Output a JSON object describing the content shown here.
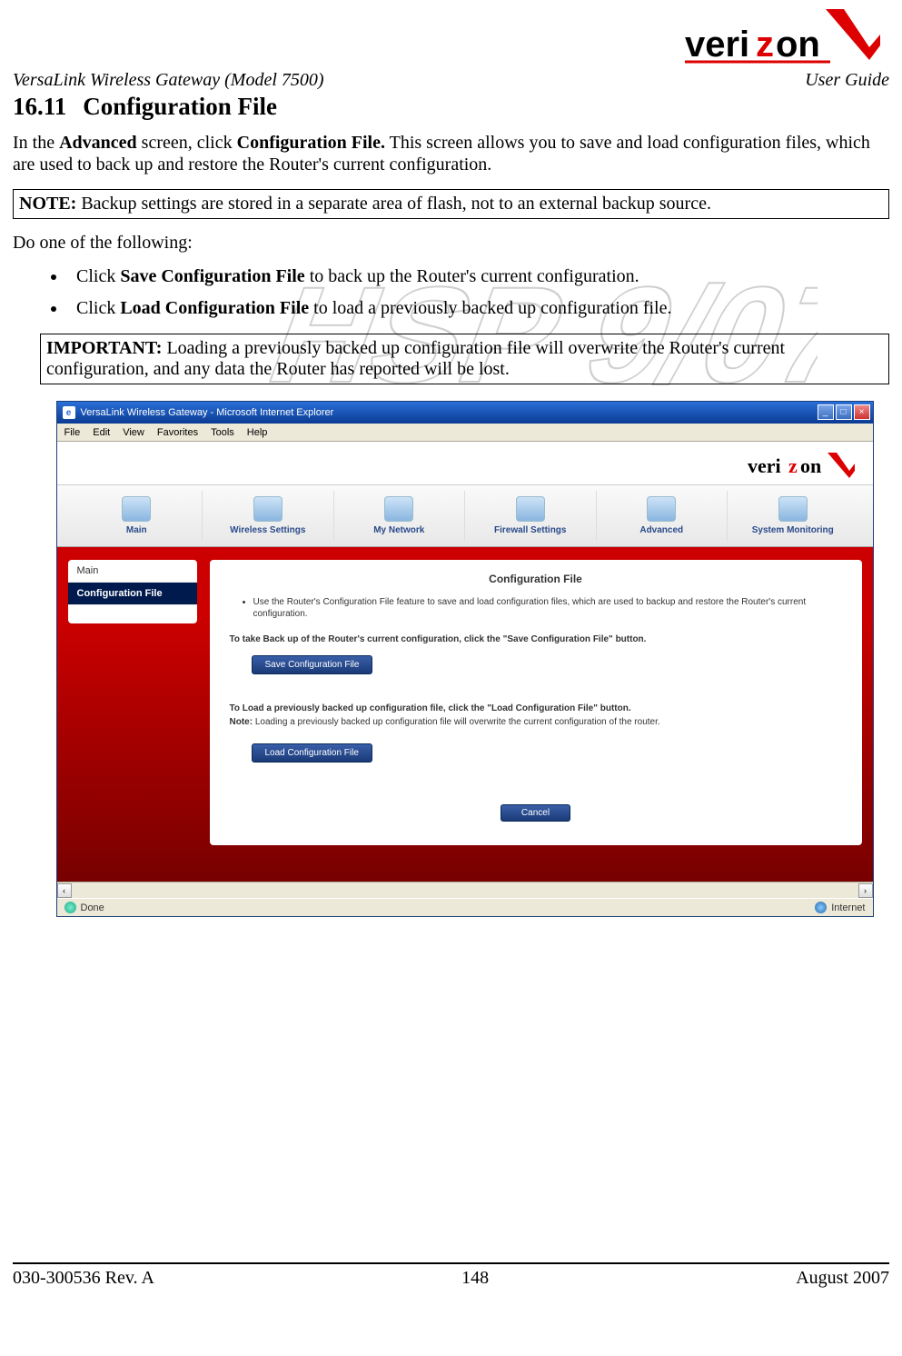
{
  "logo_text": "verizon",
  "doc_header_left": "VersaLink Wireless Gateway (Model 7500)",
  "doc_header_right": "User Guide",
  "section_number": "16.11",
  "section_title": "Configuration File",
  "intro_1a": "In the ",
  "intro_1b": "Advanced",
  "intro_1c": " screen, click ",
  "intro_1d": "Configuration File.",
  "intro_1e": " This screen allows you to save and load configuration files, which are used to back up and restore the Router's current configuration.",
  "note_label": "NOTE:",
  "note_text": " Backup settings are stored in a separate area of flash, not to an external backup source.",
  "do_one": "Do one of the following:",
  "bullet1_a": "Click ",
  "bullet1_b": "Save Configuration File",
  "bullet1_c": " to back up the Router's current configuration.",
  "bullet2_a": "Click ",
  "bullet2_b": "Load Configuration File",
  "bullet2_c": " to load a previously backed up configuration file.",
  "important_label": "IMPORTANT:",
  "important_text": " Loading a previously backed up configuration file will overwrite the Router's current configuration, and any data the Router has reported will be lost.",
  "screenshot": {
    "window_title": "VersaLink Wireless Gateway - Microsoft Internet Explorer",
    "menu": [
      "File",
      "Edit",
      "View",
      "Favorites",
      "Tools",
      "Help"
    ],
    "tabs": [
      "Main",
      "Wireless Settings",
      "My Network",
      "Firewall Settings",
      "Advanced",
      "System Monitoring"
    ],
    "sidebar": {
      "item_main": "Main",
      "item_config": "Configuration File"
    },
    "panel_title": "Configuration File",
    "panel_bullet": "Use the Router's Configuration File feature to save and load configuration files, which are used to backup and restore the Router's current configuration.",
    "backup_heading": "To take Back up of the Router's current configuration, click the \"Save Configuration File\" button.",
    "save_btn": "Save Configuration File",
    "load_heading": "To Load a previously backed up configuration file, click the \"Load Configuration File\" button.",
    "load_note_label": "Note:",
    "load_note": " Loading a previously backed up configuration file will overwrite the current configuration of the router.",
    "load_btn": "Load Configuration File",
    "cancel_btn": "Cancel",
    "status_left": "Done",
    "status_right": "Internet"
  },
  "footer_left": "030-300536 Rev. A",
  "footer_center": "148",
  "footer_right": "August 2007"
}
